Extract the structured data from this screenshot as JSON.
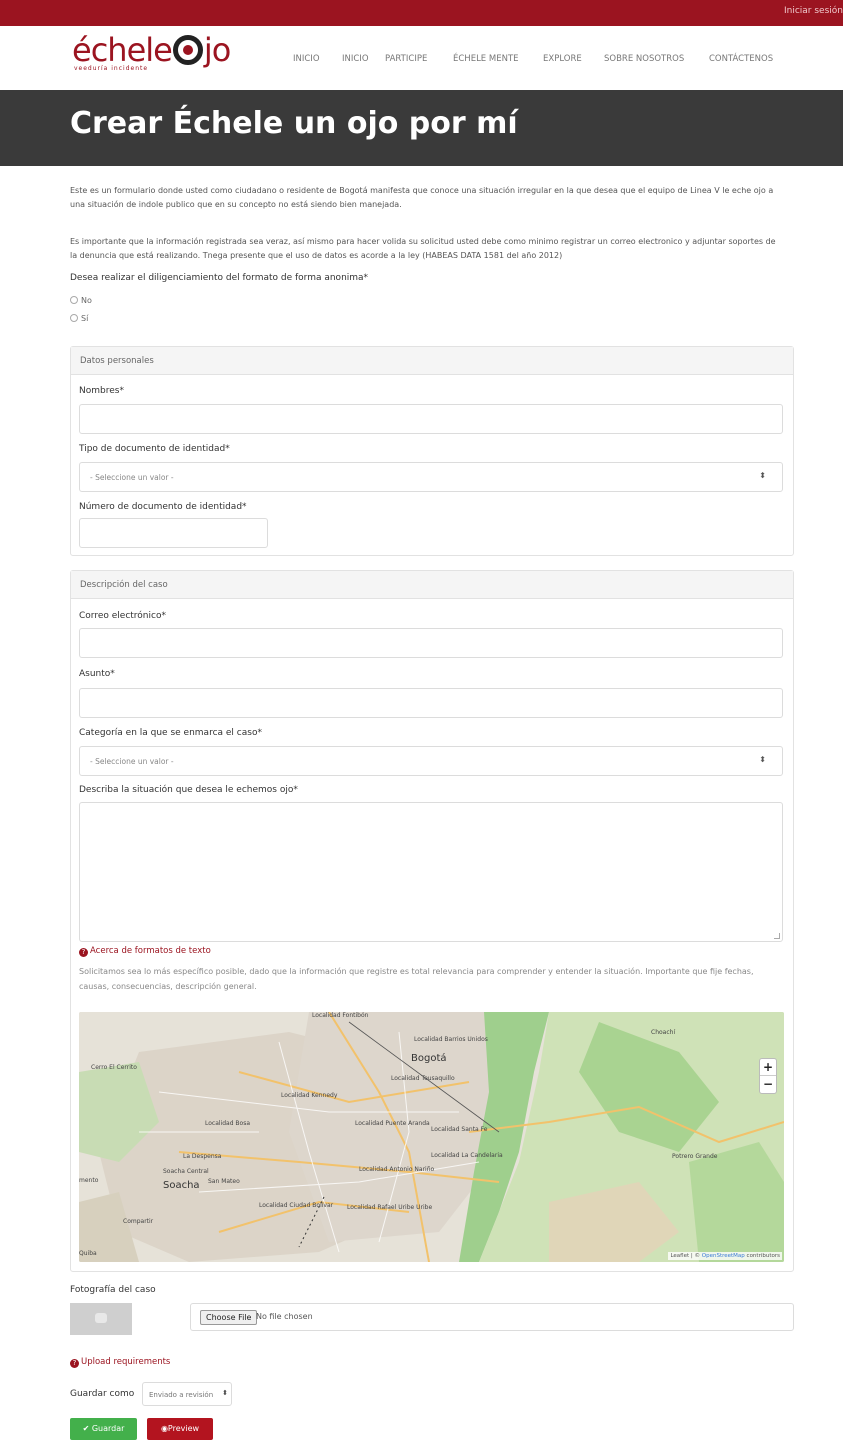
{
  "header": {
    "login_label": "Iniciar sesión",
    "logo_text_before": "échele",
    "logo_text_after": "jo",
    "logo_sub": "veeduría incidente",
    "nav": [
      {
        "label": "INICIO"
      },
      {
        "label": "INICIO"
      },
      {
        "label": "PARTICIPE"
      },
      {
        "label": "ÉCHELE MENTE"
      },
      {
        "label": "EXPLORE"
      },
      {
        "label": "SOBRE NOSOTROS"
      },
      {
        "label": "CONTÁCTENOS"
      }
    ],
    "brand_color": "#9b1420"
  },
  "page": {
    "title": "Crear Échele un ojo por mí",
    "intro_1": "Este es un formulario donde usted como ciudadano o residente de Bogotá manifesta que conoce una situación irregular en la que desea que el equipo de Linea V le eche ojo a una situación de indole publico que en su concepto no está siendo bien manejada.",
    "intro_2": "Es importante que la información registrada sea veraz, así mismo para hacer volida su solicitud usted debe como minimo registrar un correo electronico y adjuntar soportes de la denuncia que está realizando. Tnega presente que el uso de datos es acorde a la ley (HABEAS DATA 1581 del año 2012)"
  },
  "form": {
    "anon_question": "Desea realizar el diligenciamiento del formato de forma anonima*",
    "anon_options": [
      "No",
      "Sí"
    ],
    "personal": {
      "heading": "Datos personales",
      "names_label": "Nombres*",
      "doc_type_label": "Tipo de documento de identidad*",
      "doc_type_value": "- Seleccione un valor -",
      "doc_number_label": "Número de documento de identidad*"
    },
    "case": {
      "heading": "Descripción del caso",
      "email_label": "Correo electrónico*",
      "subject_label": "Asunto*",
      "category_label": "Categoría en la que se enmarca el caso*",
      "category_value": "- Seleccione un valor -",
      "description_label": "Describa la situación que desea le echemos ojo*",
      "text_formats_link": "Acerca de formatos de texto",
      "help_text": "Solicitamos sea lo más específico posible, dado que la información que registre es total relevancia para comprender y entender la situación. Importante que fije fechas, causas, consecuencias, descripción general."
    },
    "map": {
      "labels": {
        "fontibon": "Localidad Fontibón",
        "barrios_unidos": "Localidad Barrios Unidos",
        "bogota": "Bogotá",
        "teusaquillo": "Localidad Teusaquillo",
        "kennedy": "Localidad Kennedy",
        "bosa": "Localidad Bosa",
        "puente_aranda": "Localidad Puente Aranda",
        "santa_fe": "Localidad Santa Fe",
        "candelaria": "Localidad La Candelaria",
        "despensa": "La Despensa",
        "soacha_central": "Soacha Central",
        "soacha": "Soacha",
        "san_mateo": "San Mateo",
        "antonio_narino": "Localidad Antonio Nariño",
        "ciudad_bolivar": "Localidad Ciudad Bolívar",
        "rafael_uribe": "Localidad Rafael Uribe Uribe",
        "compartir": "Compartir",
        "choachi": "Choachí",
        "portero_grande": "Potrero Grande",
        "cerro": "Cerro El Cerrito",
        "quiba": "Quiba",
        "mento": "mento"
      },
      "zoom_in": "+",
      "zoom_out": "−",
      "attribution_prefix": "Leaflet | © ",
      "attribution_link": "OpenStreetMap",
      "attribution_suffix": " contributors"
    },
    "photo_label": "Fotografía del caso",
    "file_button": "Choose File",
    "file_status": "No file chosen",
    "upload_link": "Upload requirements",
    "save_as_label": "Guardar como",
    "save_as_value": "Enviado a revisión",
    "save_button": "Guardar",
    "preview_button": "Preview"
  }
}
